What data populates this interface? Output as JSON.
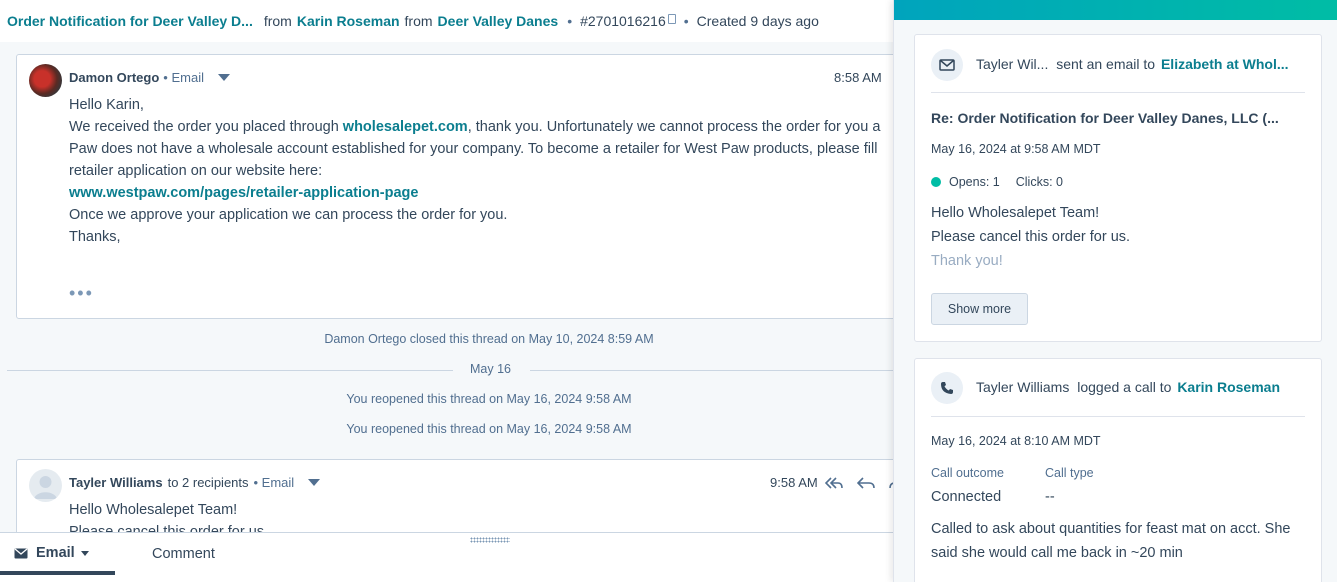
{
  "header": {
    "ticket_title": "Order Notification for Deer Valley D...",
    "from1": "from",
    "contact": "Karin Roseman",
    "from2": "from",
    "company": "Deer Valley Danes",
    "bullet": "•",
    "ticket_id": "#2701016216",
    "created": "Created 9 days ago"
  },
  "thread": {
    "email1": {
      "sender": "Damon Ortego",
      "channel": "• Email",
      "time": "8:58 AM",
      "lines": [
        "Hello Karin,",
        "We received the order you placed through ",
        "wholesalepet.com",
        ", thank you.  Unfortunately we cannot process the order for you a",
        "Paw does not have a wholesale account established for your company.  To become a retailer for West Paw products, please fill",
        "retailer application on our website here:",
        "www.westpaw.com/pages/retailer-application-page",
        "Once we approve your application we can process the order for you.",
        "Thanks,"
      ],
      "more": "•••"
    },
    "events": [
      "Damon Ortego closed this thread on May 10, 2024 8:59 AM",
      "You reopened this thread on May 16, 2024 9:58 AM",
      "You reopened this thread on May 16, 2024 9:58 AM"
    ],
    "date_separator": "May 16",
    "email2": {
      "sender": "Tayler Williams",
      "recipients": "to 2 recipients",
      "channel": "• Email",
      "time": "9:58 AM",
      "lines": [
        "Hello Wholesalepet Team!",
        "Please cancel this order for us."
      ]
    }
  },
  "composer": {
    "tab_email": "Email",
    "tab_comment": "Comment"
  },
  "activity": {
    "email": {
      "actor": "Tayler Wil...",
      "action": "sent an email to",
      "recipient": "Elizabeth at Whol...",
      "subject": "Re: Order Notification for Deer Valley Danes, LLC (...",
      "datetime": "May 16, 2024 at 9:58 AM MDT",
      "opens": "Opens: 1",
      "clicks": "Clicks: 0",
      "body": [
        "Hello Wholesalepet Team!",
        "Please cancel this order for us.",
        "Thank you!"
      ],
      "show_more": "Show more"
    },
    "call": {
      "actor": "Tayler Williams",
      "action": "logged a call to",
      "contact": "Karin Roseman",
      "datetime": "May 16, 2024 at 8:10 AM MDT",
      "outcome_label": "Call outcome",
      "outcome_value": "Connected",
      "type_label": "Call type",
      "type_value": "--",
      "note": "Called to ask about quantities for feast mat on acct. She said she would call me back in ~20 min"
    }
  },
  "colors": {
    "link": "#0b7e8f",
    "accent": "#00bda5",
    "text": "#33475b"
  }
}
